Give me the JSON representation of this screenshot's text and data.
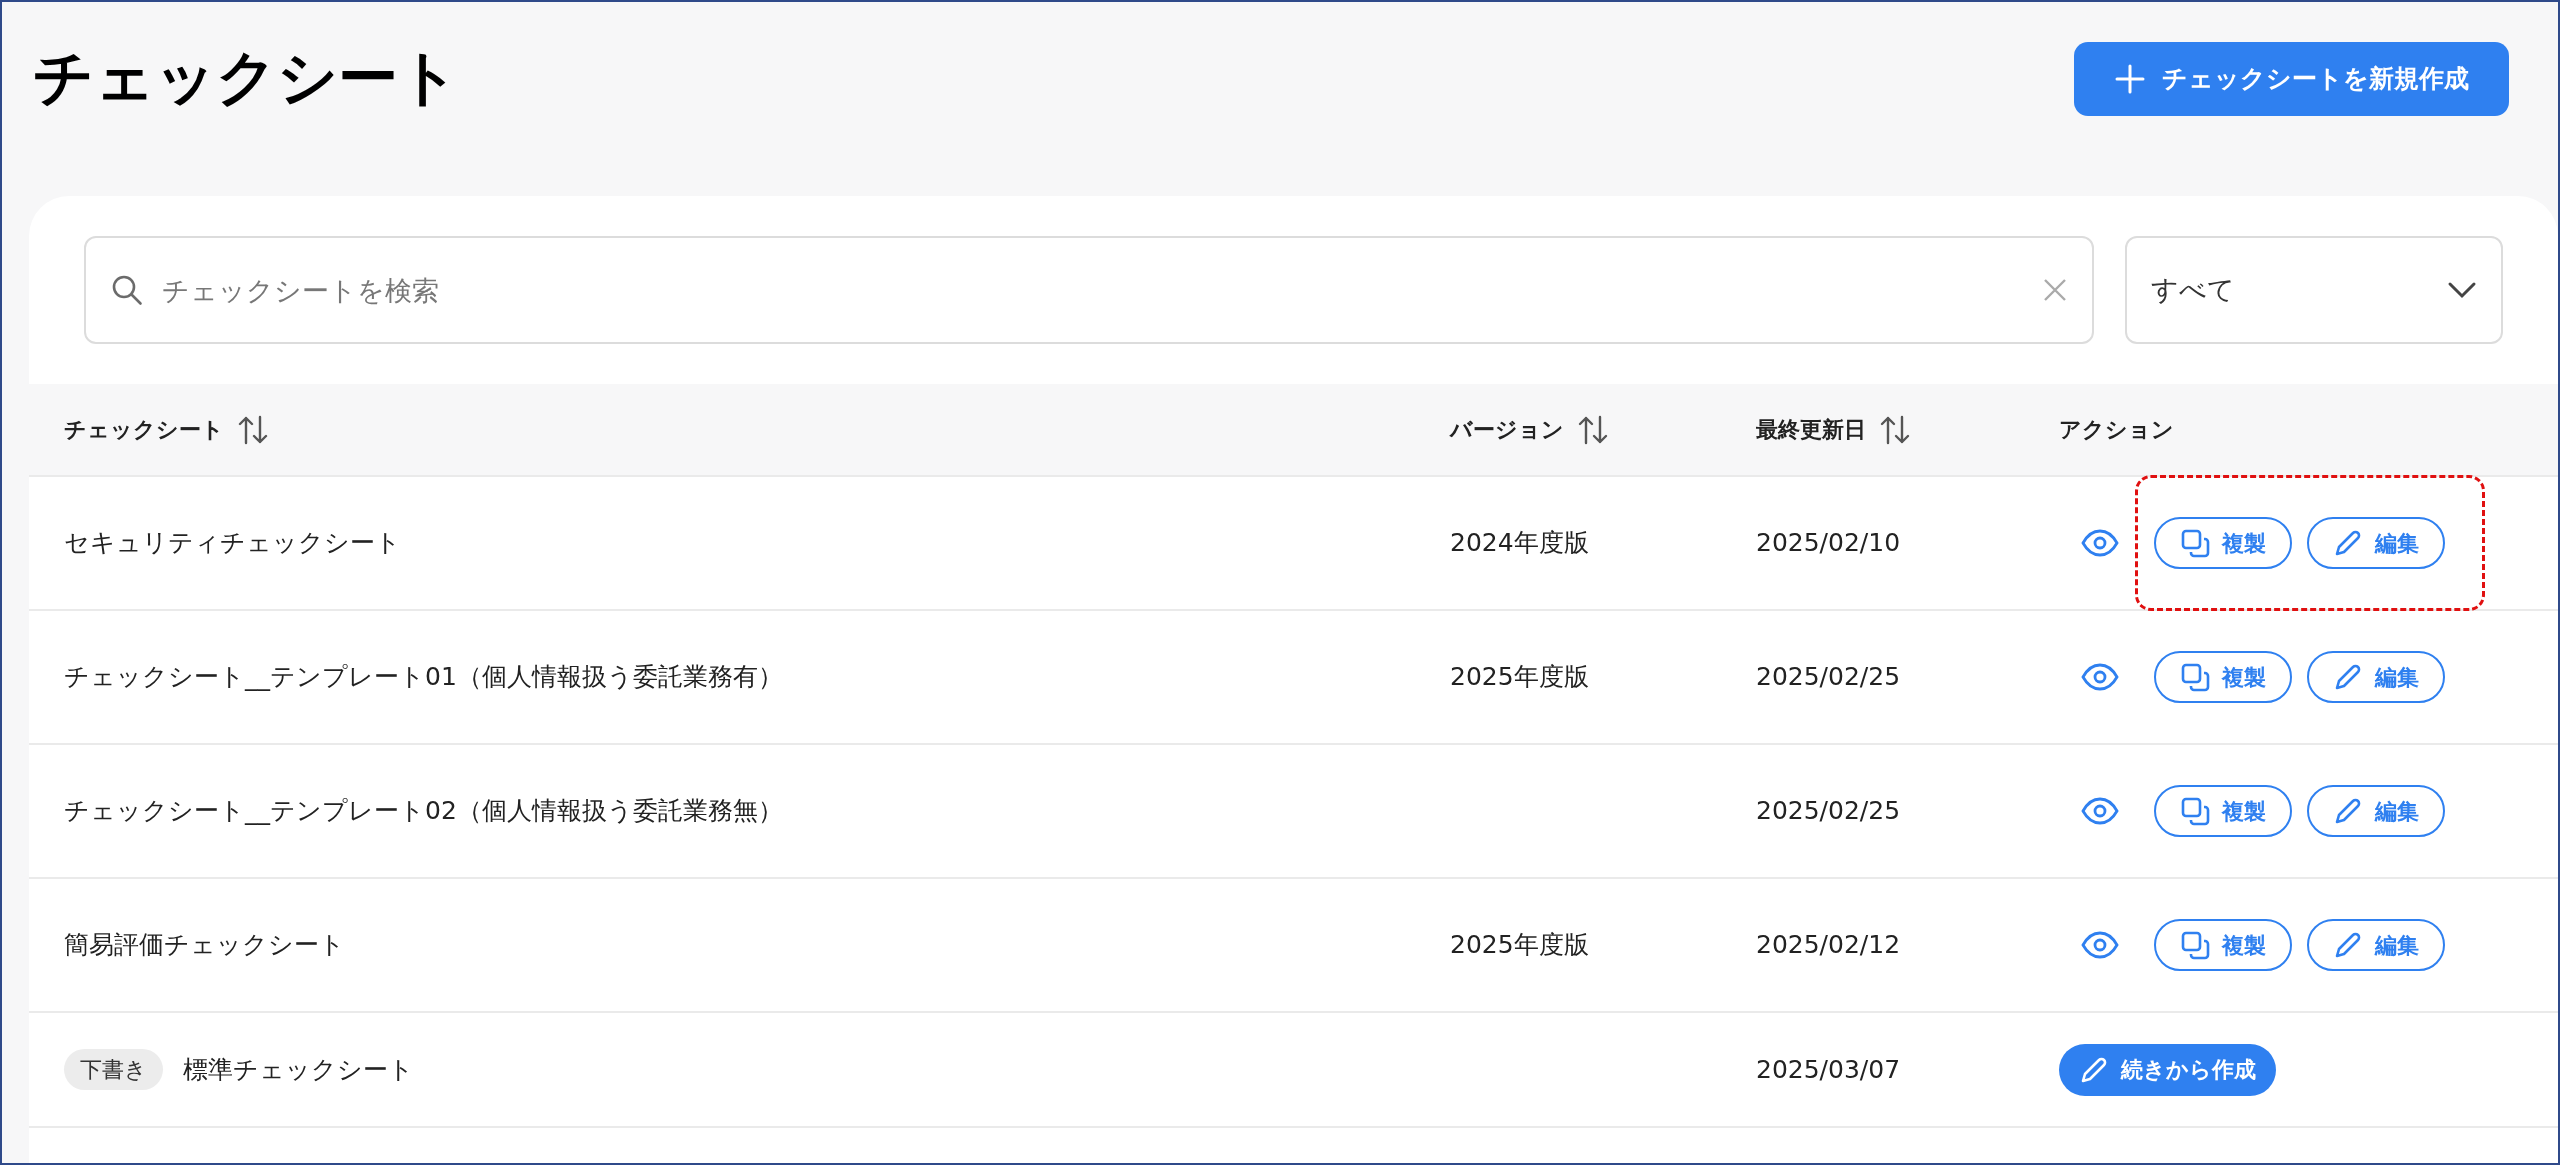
{
  "page": {
    "title": "チェックシート",
    "create_button": "チェックシートを新規作成"
  },
  "search": {
    "placeholder": "チェックシートを検索"
  },
  "filter": {
    "value": "すべて"
  },
  "table": {
    "columns": [
      {
        "label": "チェックシート",
        "sortable": true
      },
      {
        "label": "バージョン",
        "sortable": true
      },
      {
        "label": "最終更新日",
        "sortable": true
      },
      {
        "label": "アクション",
        "sortable": false
      }
    ],
    "rows": [
      {
        "kind": "published",
        "name": "セキュリティチェックシート",
        "version": "2024年度版",
        "updated": "2025/02/10",
        "highlighted": true,
        "actions": [
          "複製",
          "編集"
        ]
      },
      {
        "kind": "published",
        "name": "チェックシート__テンプレート01（個人情報扱う委託業務有）",
        "version": "2025年度版",
        "updated": "2025/02/25",
        "highlighted": false,
        "actions": [
          "複製",
          "編集"
        ]
      },
      {
        "kind": "published",
        "name": "チェックシート__テンプレート02（個人情報扱う委託業務無）",
        "updated": "2025/02/25",
        "highlighted": false,
        "actions": [
          "複製",
          "編集"
        ]
      },
      {
        "kind": "published",
        "name": "簡易評価チェックシート",
        "version": "2025年度版",
        "updated": "2025/02/12",
        "highlighted": false,
        "actions": [
          "複製",
          "編集"
        ]
      },
      {
        "kind": "draft",
        "tag": "下書き",
        "name": "標準チェックシート",
        "updated": "2025/03/07",
        "action": "続きから作成"
      }
    ]
  }
}
